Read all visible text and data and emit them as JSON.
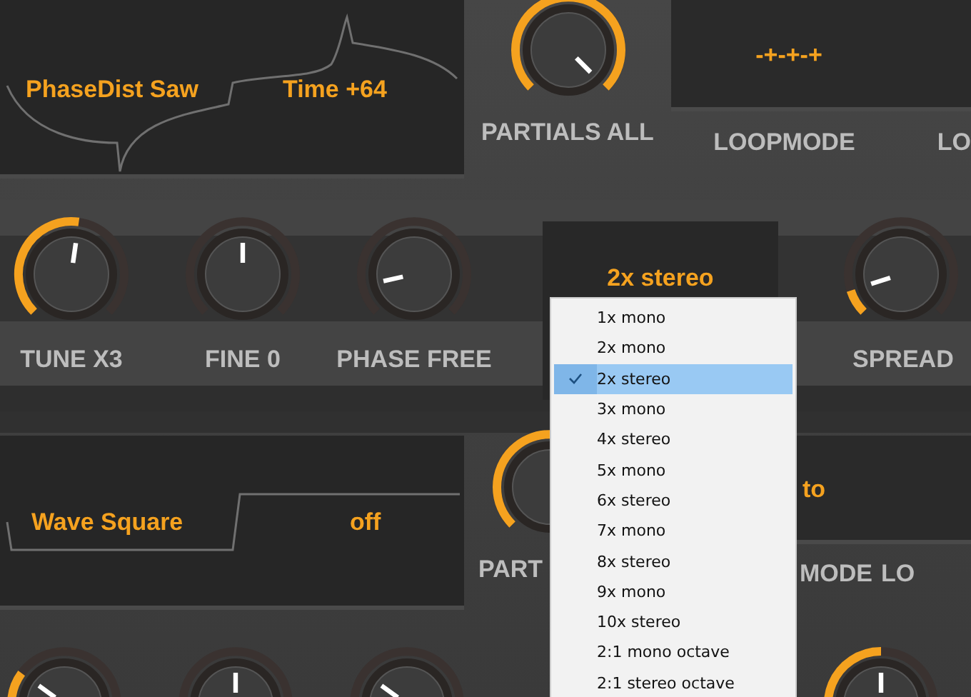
{
  "oscillators": [
    {
      "display": {
        "wave": "PhaseDist Saw",
        "param": "Time +64",
        "kind": "saw"
      },
      "partials": {
        "label": "PARTIALS ALL",
        "level": 1,
        "kind": "arc"
      },
      "loop_display": "-+-+-+",
      "labels": [
        "LOOPMODE",
        "LO"
      ]
    },
    {
      "display": {
        "wave": "Wave Square",
        "param": "off",
        "kind": "square"
      },
      "partials": {
        "label": "PART",
        "level": 1,
        "kind": "arc"
      },
      "loop_display": "to",
      "labels": [
        "MODE",
        "LO"
      ]
    }
  ],
  "voice_row": {
    "knobs": [
      {
        "label": "TUNE X3",
        "level": 0.53,
        "kind": "arc"
      },
      {
        "label": "FINE 0",
        "level": 0.5,
        "kind": "plain"
      },
      {
        "label": "PHASE FREE",
        "level": 0.12,
        "kind": "plain"
      }
    ],
    "unison_display": "2x stereo",
    "spread": {
      "label": "SPREAD",
      "level": 0.1,
      "kind": "arc"
    }
  },
  "bottom_knobs": [
    {
      "level": 0.3,
      "kind": "arc"
    },
    {
      "level": 0.5,
      "kind": "plain"
    },
    {
      "level": 0.3,
      "kind": "plain"
    },
    {
      "level": 0.5,
      "kind": "arc"
    }
  ],
  "menu": [
    {
      "label": "1x mono",
      "selected": false
    },
    {
      "label": "2x mono",
      "selected": false
    },
    {
      "label": "2x stereo",
      "selected": true
    },
    {
      "label": "3x mono",
      "selected": false
    },
    {
      "label": "4x stereo",
      "selected": false
    },
    {
      "label": "5x mono",
      "selected": false
    },
    {
      "label": "6x stereo",
      "selected": false
    },
    {
      "label": "7x mono",
      "selected": false
    },
    {
      "label": "8x stereo",
      "selected": false
    },
    {
      "label": "9x mono",
      "selected": false
    },
    {
      "label": "10x stereo",
      "selected": false
    },
    {
      "label": "2:1 mono octave",
      "selected": false
    },
    {
      "label": "2:1 stereo octave",
      "selected": false
    }
  ]
}
